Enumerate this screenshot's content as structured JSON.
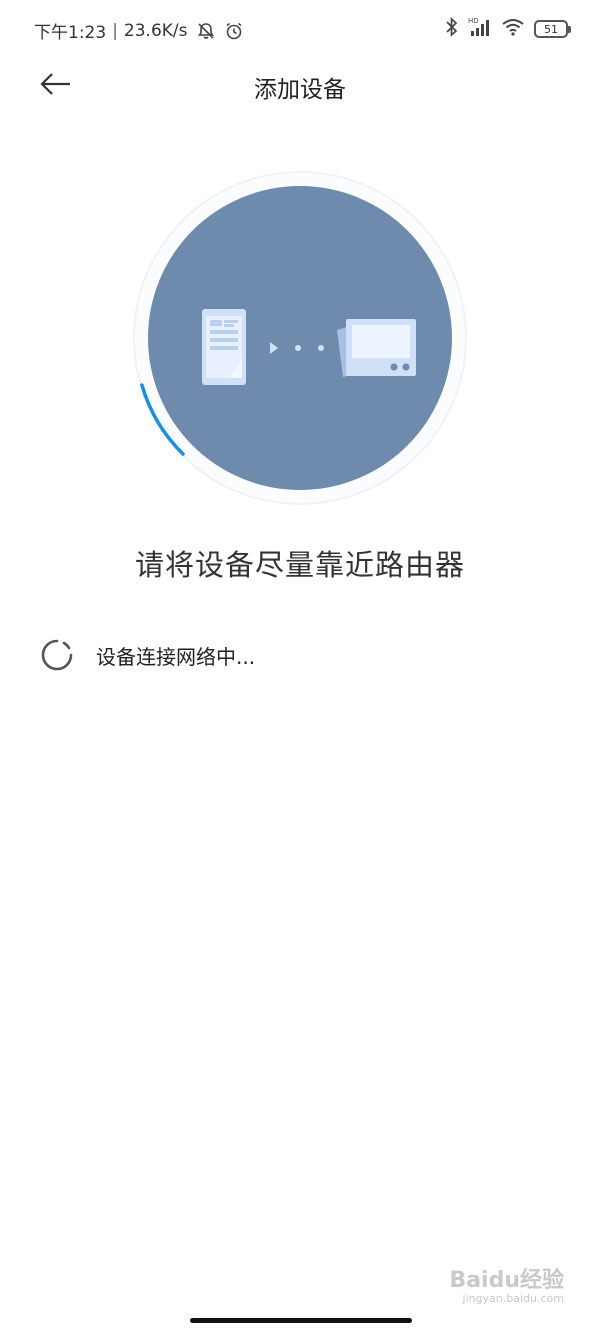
{
  "statusbar": {
    "time": "下午1:23",
    "separator": "|",
    "speed": "23.6K/s",
    "battery": "51",
    "hd_label": "HD"
  },
  "header": {
    "title": "添加设备"
  },
  "main": {
    "headline": "请将设备尽量靠近路由器",
    "status_text": "设备连接网络中..."
  },
  "watermark": {
    "brand": "Baidu经验",
    "url": "jingyan.baidu.com"
  },
  "colors": {
    "circle": "#6e8aad",
    "progress_arc": "#1a8fe0",
    "device_fill": "#cfe0f7"
  },
  "icons": [
    "back-arrow-icon",
    "bell-off-icon",
    "alarm-icon",
    "bluetooth-icon",
    "signal-icon",
    "wifi-icon",
    "battery-icon",
    "phone-icon",
    "router-icon",
    "loading-spinner-icon"
  ]
}
